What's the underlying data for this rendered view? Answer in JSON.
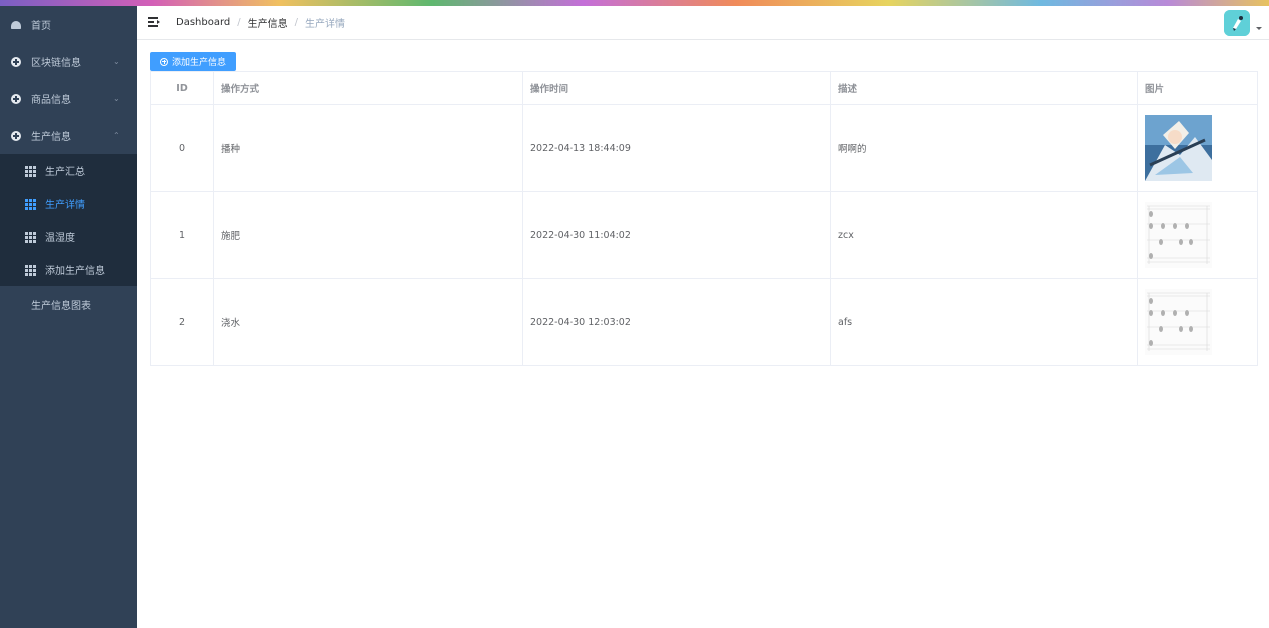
{
  "sidebar": {
    "items": [
      {
        "label": "首页",
        "icon": "dashboard-icon"
      },
      {
        "label": "区块链信息",
        "icon": "plus-circle-icon"
      },
      {
        "label": "商品信息",
        "icon": "plus-circle-icon"
      },
      {
        "label": "生产信息",
        "icon": "plus-circle-icon"
      }
    ],
    "submenu": [
      {
        "label": "生产汇总",
        "icon": "grid-icon"
      },
      {
        "label": "生产详情",
        "icon": "grid-icon"
      },
      {
        "label": "温湿度",
        "icon": "grid-icon"
      },
      {
        "label": "添加生产信息",
        "icon": "grid-icon"
      }
    ],
    "last_item": {
      "label": "生产信息图表",
      "icon": "grid-icon"
    }
  },
  "header": {
    "breadcrumb": [
      "Dashboard",
      "生产信息",
      "生产详情"
    ],
    "separator": "/"
  },
  "main": {
    "add_button_label": "添加生产信息",
    "table": {
      "columns": [
        "ID",
        "操作方式",
        "操作时间",
        "描述",
        "图片"
      ],
      "rows": [
        {
          "id": "0",
          "method": "播种",
          "time": "2022-04-13 18:44:09",
          "desc": "啊啊的",
          "image": "anime-figure-thumbnail"
        },
        {
          "id": "1",
          "method": "施肥",
          "time": "2022-04-30 11:04:02",
          "desc": "zcx",
          "image": "sheet-music-thumbnail"
        },
        {
          "id": "2",
          "method": "浇水",
          "time": "2022-04-30 12:03:02",
          "desc": "afs",
          "image": "sheet-music-thumbnail"
        }
      ]
    }
  },
  "colors": {
    "sidebar_bg": "#304156",
    "submenu_bg": "#1f2d3d",
    "accent": "#409eff",
    "avatar_bg": "#5fd0d8"
  }
}
